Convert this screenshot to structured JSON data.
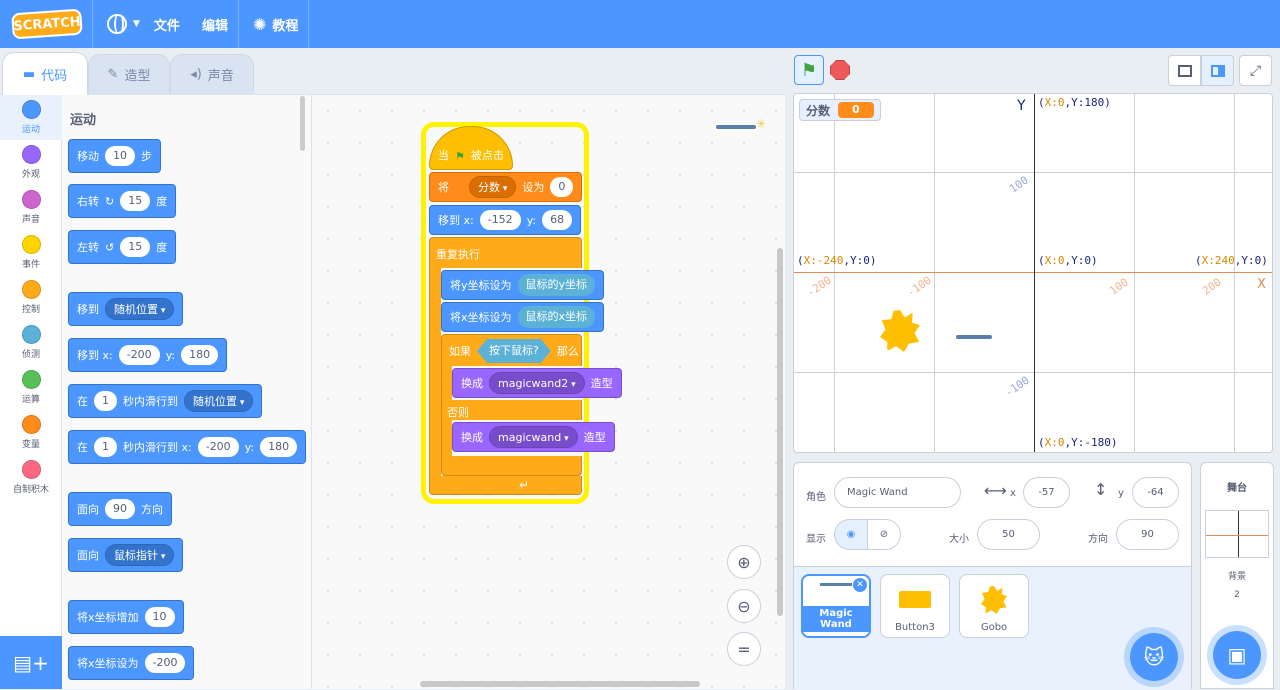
{
  "menu": {
    "logo": "SCRATCH",
    "file": "文件",
    "edit": "编辑",
    "tutorials": "教程"
  },
  "tabs": {
    "code": "代码",
    "costumes": "造型",
    "sounds": "声音"
  },
  "categories": [
    {
      "label": "运动",
      "color": "#4c97ff"
    },
    {
      "label": "外观",
      "color": "#9966ff"
    },
    {
      "label": "声音",
      "color": "#cf63cf"
    },
    {
      "label": "事件",
      "color": "#ffd500"
    },
    {
      "label": "控制",
      "color": "#ffab19"
    },
    {
      "label": "侦测",
      "color": "#5cb1d6"
    },
    {
      "label": "运算",
      "color": "#59c059"
    },
    {
      "label": "变量",
      "color": "#ff8c1a"
    },
    {
      "label": "自制积木",
      "color": "#ff6680"
    }
  ],
  "palette": {
    "title": "运动",
    "move": {
      "label": "移动",
      "steps": "10",
      "unit": "步"
    },
    "turn_right": {
      "label": "右转",
      "deg": "15",
      "unit": "度"
    },
    "turn_left": {
      "label": "左转",
      "deg": "15",
      "unit": "度"
    },
    "goto": {
      "label": "移到",
      "target": "随机位置"
    },
    "goto_xy": {
      "label": "移到 x:",
      "x": "-200",
      "ylabel": "y:",
      "y": "180"
    },
    "glide": {
      "label": "在",
      "secs": "1",
      "mid": "秒内滑行到",
      "target": "随机位置"
    },
    "glide_xy": {
      "label": "在",
      "secs": "1",
      "mid": "秒内滑行到 x:",
      "x": "-200",
      "ylabel": "y:",
      "y": "180"
    },
    "point_dir": {
      "label": "面向",
      "deg": "90",
      "unit": "方向"
    },
    "point_towards": {
      "label": "面向",
      "target": "鼠标指针"
    },
    "change_x": {
      "label": "将x坐标增加",
      "val": "10"
    },
    "set_x": {
      "label": "将x坐标设为",
      "val": "-200"
    }
  },
  "script": {
    "hat": {
      "when": "当",
      "clicked": "被点击"
    },
    "setvar": {
      "label": "将",
      "var": "分数",
      "to": "设为",
      "val": "0"
    },
    "goto": {
      "label": "移到 x:",
      "x": "-152",
      "ylabel": "y:",
      "y": "68"
    },
    "forever": "重复执行",
    "sety": {
      "label": "将y坐标设为",
      "val": "鼠标的y坐标"
    },
    "setx": {
      "label": "将x坐标设为",
      "val": "鼠标的x坐标"
    },
    "if": {
      "label": "如果",
      "cond": "按下鼠标?",
      "then": "那么"
    },
    "switch1": {
      "label": "换成",
      "costume": "magicwand2",
      "suffix": "造型"
    },
    "else": "否则",
    "switch2": {
      "label": "换成",
      "costume": "magicwand",
      "suffix": "造型"
    }
  },
  "stage": {
    "score_label": "分数",
    "score_value": "0",
    "y_axis": "Y",
    "x_axis": "X",
    "top": {
      "x": "X:0",
      "y": "Y:180"
    },
    "left": {
      "x": "X:-240",
      "y": "Y:0"
    },
    "center": {
      "x": "X:0",
      "y": "Y:0"
    },
    "right": {
      "x": "X:240",
      "y": "Y:0"
    },
    "bottom": {
      "x": "X:0",
      "y": "Y:-180"
    },
    "ticks": {
      "y100": "100",
      "y_100": "-100",
      "x_200": "-200",
      "x_100": "-100",
      "x100": "100",
      "x200": "200"
    }
  },
  "sprite_info": {
    "sprite_label": "角色",
    "sprite_name": "Magic Wand",
    "x_label": "x",
    "x": "-57",
    "y_label": "y",
    "y": "-64",
    "show_label": "显示",
    "size_label": "大小",
    "size": "50",
    "dir_label": "方向",
    "dir": "90"
  },
  "sprites": [
    {
      "name": "Magic Wand"
    },
    {
      "name": "Button3"
    },
    {
      "name": "Gobo"
    }
  ],
  "stage_pane": {
    "title": "舞台",
    "backdrops_label": "背景",
    "backdrops": "2"
  }
}
